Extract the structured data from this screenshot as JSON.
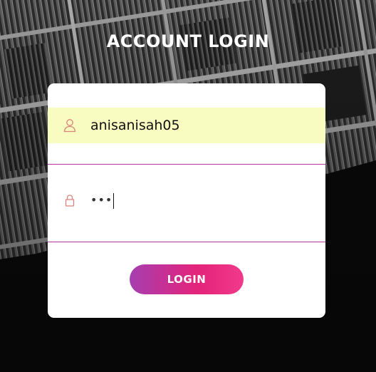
{
  "header": {
    "title": "ACCOUNT LOGIN"
  },
  "form": {
    "username": {
      "icon": "user-icon",
      "value": "anisanisah05"
    },
    "password": {
      "icon": "lock-icon",
      "masked_value": "•••"
    },
    "submit_label": "LOGIN"
  },
  "colors": {
    "accent_start": "#a63eb0",
    "accent_end": "#f03a8a",
    "divider": "#b03a9a",
    "autofill_bg": "#f9fcc0",
    "icon": "#d9837a"
  }
}
